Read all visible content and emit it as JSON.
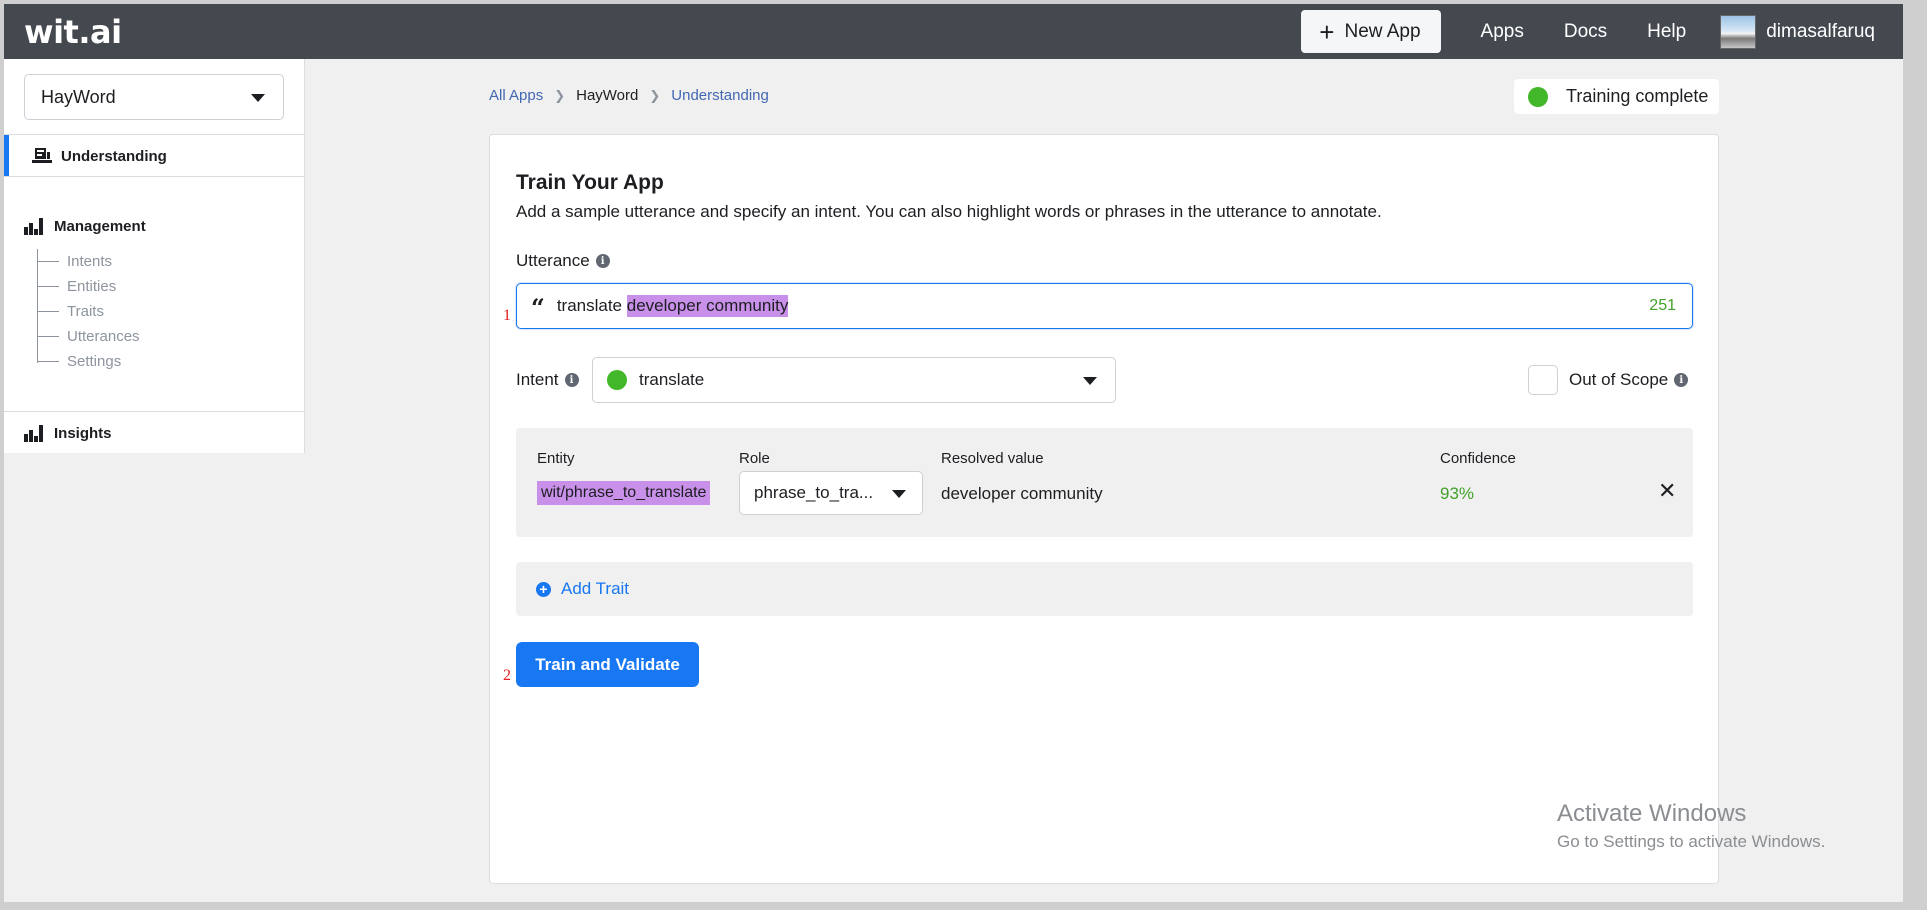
{
  "header": {
    "logo": "wit.ai",
    "new_app_label": "New App",
    "nav": [
      "Apps",
      "Docs",
      "Help"
    ],
    "username": "dimasalfaruq"
  },
  "sidebar": {
    "app_selected": "HayWord",
    "understanding_label": "Understanding",
    "management_label": "Management",
    "management_items": [
      "Intents",
      "Entities",
      "Traits",
      "Utterances",
      "Settings"
    ],
    "insights_label": "Insights"
  },
  "breadcrumb": {
    "all_apps": "All Apps",
    "app": "HayWord",
    "section": "Understanding"
  },
  "status": {
    "text": "Training complete",
    "color": "#42b72a"
  },
  "train": {
    "title": "Train Your App",
    "subtitle": "Add a sample utterance and specify an intent. You can also highlight words or phrases in the utterance to annotate.",
    "utterance_label": "Utterance",
    "utterance_plain": "translate ",
    "utterance_highlight": "developer community",
    "char_count": "251",
    "intent_label": "Intent",
    "intent_value": "translate",
    "out_of_scope_label": "Out of Scope",
    "marker_1": "1",
    "marker_2": "2",
    "entity": {
      "col_entity": "Entity",
      "col_role": "Role",
      "col_resolved": "Resolved value",
      "col_confidence": "Confidence",
      "entity_name": "wit/phrase_to_translate",
      "role_value": "phrase_to_tra...",
      "resolved_value": "developer community",
      "confidence": "93%"
    },
    "add_trait_label": "Add Trait",
    "train_button_label": "Train and Validate"
  },
  "watermark": {
    "title": "Activate Windows",
    "subtitle": "Go to Settings to activate Windows."
  },
  "colors": {
    "accent": "#1877f2",
    "highlight": "#c890e9",
    "topbar": "#444950"
  }
}
